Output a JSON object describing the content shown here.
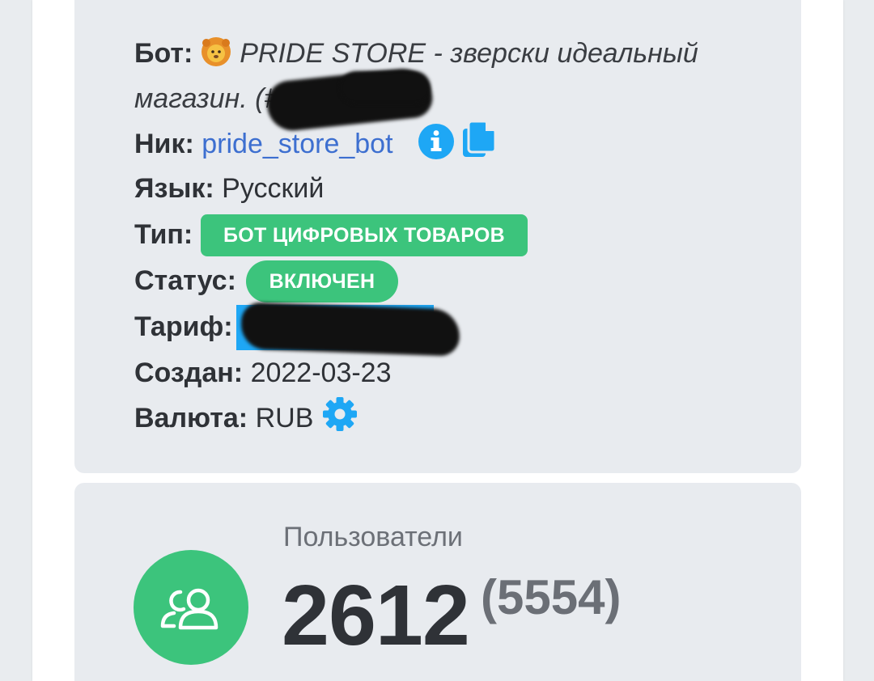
{
  "bot": {
    "label": "Бот:",
    "name": "PRIDE STORE - зверски идеальный",
    "name_line2": "магазин. (#"
  },
  "nick": {
    "label": "Ник:",
    "value": "pride_store_bot"
  },
  "language": {
    "label": "Язык:",
    "value": "Русский"
  },
  "type": {
    "label": "Тип:",
    "badge": "БОТ ЦИФРОВЫХ ТОВАРОВ"
  },
  "status": {
    "label": "Статус:",
    "badge": "ВКЛЮЧЕН"
  },
  "tariff": {
    "label": "Тариф:"
  },
  "created": {
    "label": "Создан:",
    "value": "2022-03-23"
  },
  "currency": {
    "label": "Валюта:",
    "value": "RUB"
  },
  "users": {
    "label": "Пользователи",
    "count": "2612",
    "total": "(5554)"
  },
  "colors": {
    "accent_green": "#3cc47c",
    "link_blue": "#3d6fd0",
    "icon_blue": "#1ea7f5",
    "panel_bg": "#e8ebef"
  },
  "icons": [
    "lion-emoji-icon",
    "info-icon",
    "copy-icon",
    "gear-icon",
    "users-icon"
  ]
}
